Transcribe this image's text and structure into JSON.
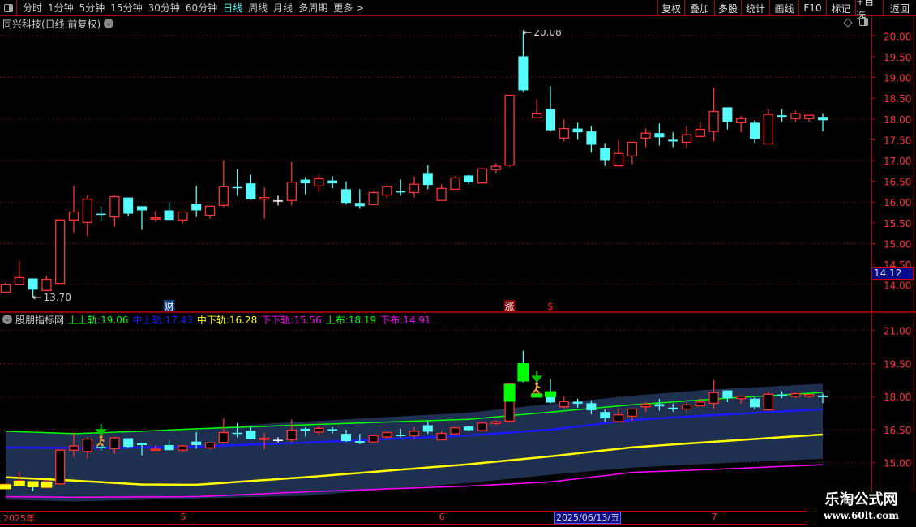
{
  "toolbar": {
    "periods": [
      "分时",
      "1分钟",
      "5分钟",
      "15分钟",
      "30分钟",
      "60分钟",
      "日线",
      "周线",
      "月线",
      "多周期",
      "更多 >"
    ],
    "active_period": "日线",
    "buttons": [
      "复权",
      "叠加",
      "多股",
      "统计",
      "画线",
      "F10",
      "标记",
      "+自选",
      "返回"
    ]
  },
  "main_title": "同兴科技(日线,前复权)",
  "indicator": {
    "name": "股朋指标网",
    "items": [
      {
        "label": "上上轨",
        "value": "19.06",
        "color": "#00ff00"
      },
      {
        "label": "中上轨",
        "value": "17.43",
        "color": "#1a1aff"
      },
      {
        "label": "中下轨",
        "value": "16.28",
        "color": "#ffff00"
      },
      {
        "label": "下下轨",
        "value": "15.56",
        "color": "#ff00ff"
      },
      {
        "label": "上布",
        "value": "18.19",
        "color": "#00ff00"
      },
      {
        "label": "下布",
        "value": "14.91",
        "color": "#ff00ff"
      }
    ]
  },
  "last_price": "14.12",
  "date_axis": {
    "labels": [
      {
        "text": "2025年",
        "bar": 1
      },
      {
        "text": "5",
        "bar": 14
      },
      {
        "text": "6",
        "bar": 33
      },
      {
        "text": "7",
        "bar": 53
      }
    ],
    "highlight": "2025/06/13/五"
  },
  "markers": [
    {
      "text": "财",
      "bar": 13,
      "type": "finance"
    },
    {
      "text": "涨",
      "bar": 38,
      "type": "limit-up"
    },
    {
      "text": "$",
      "bar": 41,
      "type": "dollar"
    }
  ],
  "signals": [
    {
      "bar": 8,
      "icon": "runner-down-arrow"
    },
    {
      "bar": 40,
      "icon": "runner-down-arrow"
    }
  ],
  "watermark": {
    "title": "乐淘公式网",
    "url": "www.60lt.com"
  },
  "colors": {
    "up": "#ff3232",
    "down": "#54fcfc",
    "flat": "#ffffff",
    "axis": "#c00000",
    "band": "#1f2f4f",
    "breakout": "#00ff00"
  },
  "chart_data": [
    {
      "type": "candlestick",
      "ylim": [
        13.4,
        20.2
      ],
      "yticks": [
        "20.00",
        "19.50",
        "19.00",
        "18.50",
        "18.00",
        "17.50",
        "17.00",
        "16.50",
        "16.00",
        "15.50",
        "15.00",
        "14.50",
        "14.00"
      ],
      "grid": true,
      "ohlc_fields": [
        "open",
        "high",
        "low",
        "close"
      ],
      "candles": [
        [
          13.83,
          14.06,
          13.83,
          14.02
        ],
        [
          14.02,
          14.59,
          14.02,
          14.18
        ],
        [
          14.16,
          14.16,
          13.7,
          13.89
        ],
        [
          13.87,
          14.22,
          13.85,
          14.14
        ],
        [
          14.04,
          15.57,
          14.04,
          15.57
        ],
        [
          15.57,
          16.39,
          15.27,
          15.76
        ],
        [
          15.51,
          16.17,
          15.18,
          16.07
        ],
        [
          15.72,
          15.88,
          15.55,
          15.7
        ],
        [
          15.64,
          16.17,
          15.41,
          16.13
        ],
        [
          16.11,
          16.11,
          15.66,
          15.72
        ],
        [
          15.9,
          15.9,
          15.33,
          15.8
        ],
        [
          15.59,
          15.78,
          15.53,
          15.62
        ],
        [
          15.8,
          16.0,
          15.57,
          15.57
        ],
        [
          15.57,
          15.76,
          15.49,
          15.76
        ],
        [
          15.96,
          16.39,
          15.64,
          15.8
        ],
        [
          15.68,
          15.92,
          15.6,
          15.9
        ],
        [
          15.92,
          17.01,
          15.88,
          16.37
        ],
        [
          16.36,
          16.8,
          16.15,
          16.34
        ],
        [
          16.45,
          16.66,
          16.05,
          16.07
        ],
        [
          16.07,
          16.35,
          15.6,
          16.11
        ],
        [
          16.04,
          16.15,
          15.92,
          16.04
        ],
        [
          16.04,
          16.97,
          15.92,
          16.48
        ],
        [
          16.54,
          16.6,
          16.19,
          16.45
        ],
        [
          16.39,
          16.66,
          16.25,
          16.56
        ],
        [
          16.52,
          16.62,
          16.33,
          16.45
        ],
        [
          16.31,
          16.5,
          15.94,
          15.98
        ],
        [
          15.98,
          16.31,
          15.84,
          15.9
        ],
        [
          15.94,
          16.27,
          15.92,
          16.23
        ],
        [
          16.17,
          16.41,
          16.09,
          16.37
        ],
        [
          16.26,
          16.54,
          16.15,
          16.24
        ],
        [
          16.23,
          16.62,
          16.11,
          16.43
        ],
        [
          16.7,
          16.89,
          16.31,
          16.41
        ],
        [
          16.04,
          16.43,
          16.04,
          16.33
        ],
        [
          16.31,
          16.62,
          16.31,
          16.58
        ],
        [
          16.64,
          16.66,
          16.43,
          16.48
        ],
        [
          16.46,
          16.8,
          16.46,
          16.8
        ],
        [
          16.78,
          16.93,
          16.7,
          16.86
        ],
        [
          16.89,
          18.57,
          16.85,
          18.57
        ],
        [
          19.51,
          20.08,
          18.65,
          18.69
        ],
        [
          18.03,
          18.48,
          18.03,
          18.14
        ],
        [
          18.24,
          18.79,
          17.7,
          17.73
        ],
        [
          17.54,
          17.99,
          17.46,
          17.77
        ],
        [
          17.77,
          17.91,
          17.5,
          17.68
        ],
        [
          17.7,
          17.83,
          17.19,
          17.38
        ],
        [
          17.3,
          17.42,
          16.87,
          17.01
        ],
        [
          16.87,
          17.48,
          16.87,
          17.17
        ],
        [
          17.11,
          17.44,
          16.91,
          17.44
        ],
        [
          17.54,
          17.77,
          17.32,
          17.66
        ],
        [
          17.66,
          17.89,
          17.36,
          17.56
        ],
        [
          17.5,
          17.68,
          17.32,
          17.46
        ],
        [
          17.44,
          17.83,
          17.3,
          17.62
        ],
        [
          17.58,
          17.93,
          17.58,
          17.75
        ],
        [
          17.7,
          18.75,
          17.46,
          18.18
        ],
        [
          18.28,
          18.28,
          17.75,
          17.93
        ],
        [
          17.91,
          18.07,
          17.68,
          18.01
        ],
        [
          17.91,
          17.97,
          17.42,
          17.52
        ],
        [
          17.4,
          18.24,
          17.4,
          18.11
        ],
        [
          18.09,
          18.24,
          17.93,
          18.05
        ],
        [
          18.01,
          18.2,
          17.93,
          18.13
        ],
        [
          18.01,
          18.09,
          17.93,
          18.09
        ],
        [
          18.05,
          18.14,
          17.7,
          17.97
        ]
      ],
      "annotations": [
        {
          "text": "20.08",
          "bar": 39,
          "kind": "high"
        },
        {
          "text": "13.70",
          "bar": 3,
          "kind": "low"
        }
      ]
    },
    {
      "type": "candlestick-with-bands",
      "ylim": [
        13.0,
        21.8
      ],
      "yticks": [
        "21.00",
        "19.50",
        "18.00",
        "16.50",
        "15.00"
      ],
      "grid": true,
      "band": {
        "upper": [
          [
            1,
            16.43
          ],
          [
            6,
            16.3
          ],
          [
            15,
            16.54
          ],
          [
            20,
            16.76
          ],
          [
            23,
            16.87
          ],
          [
            35,
            17.27
          ],
          [
            41,
            17.67
          ],
          [
            47,
            18.04
          ],
          [
            53,
            18.33
          ],
          [
            61,
            18.58
          ]
        ],
        "lower": [
          [
            1,
            13.32
          ],
          [
            6,
            13.24
          ],
          [
            23,
            13.5
          ],
          [
            35,
            14.08
          ],
          [
            41,
            14.45
          ],
          [
            47,
            14.78
          ],
          [
            53,
            14.96
          ],
          [
            61,
            15.18
          ]
        ]
      },
      "series": [
        {
          "name": "上布",
          "color": "#00ff00",
          "points": [
            [
              1,
              16.43
            ],
            [
              6,
              16.32
            ],
            [
              11,
              16.43
            ],
            [
              15,
              16.54
            ],
            [
              20,
              16.65
            ],
            [
              23,
              16.72
            ],
            [
              35,
              16.97
            ],
            [
              41,
              17.3
            ],
            [
              47,
              17.63
            ],
            [
              53,
              17.89
            ],
            [
              61,
              18.19
            ]
          ]
        },
        {
          "name": "中上轨",
          "color": "#1a1aff",
          "points": [
            [
              1,
              15.69
            ],
            [
              8,
              15.67
            ],
            [
              15,
              15.73
            ],
            [
              23,
              15.91
            ],
            [
              35,
              16.24
            ],
            [
              41,
              16.5
            ],
            [
              47,
              16.94
            ],
            [
              53,
              17.16
            ],
            [
              61,
              17.43
            ]
          ]
        },
        {
          "name": "中下轨",
          "color": "#ffff00",
          "points": [
            [
              1,
              14.34
            ],
            [
              6,
              14.19
            ],
            [
              11,
              14.01
            ],
            [
              15,
              14.0
            ],
            [
              23,
              14.34
            ],
            [
              35,
              14.93
            ],
            [
              41,
              15.29
            ],
            [
              47,
              15.7
            ],
            [
              53,
              15.95
            ],
            [
              61,
              16.28
            ]
          ]
        },
        {
          "name": "下布",
          "color": "#ff00ff",
          "points": [
            [
              1,
              13.46
            ],
            [
              6,
              13.43
            ],
            [
              15,
              13.46
            ],
            [
              23,
              13.68
            ],
            [
              35,
              13.94
            ],
            [
              41,
              14.13
            ],
            [
              47,
              14.56
            ],
            [
              53,
              14.7
            ],
            [
              61,
              14.91
            ]
          ]
        }
      ]
    }
  ]
}
